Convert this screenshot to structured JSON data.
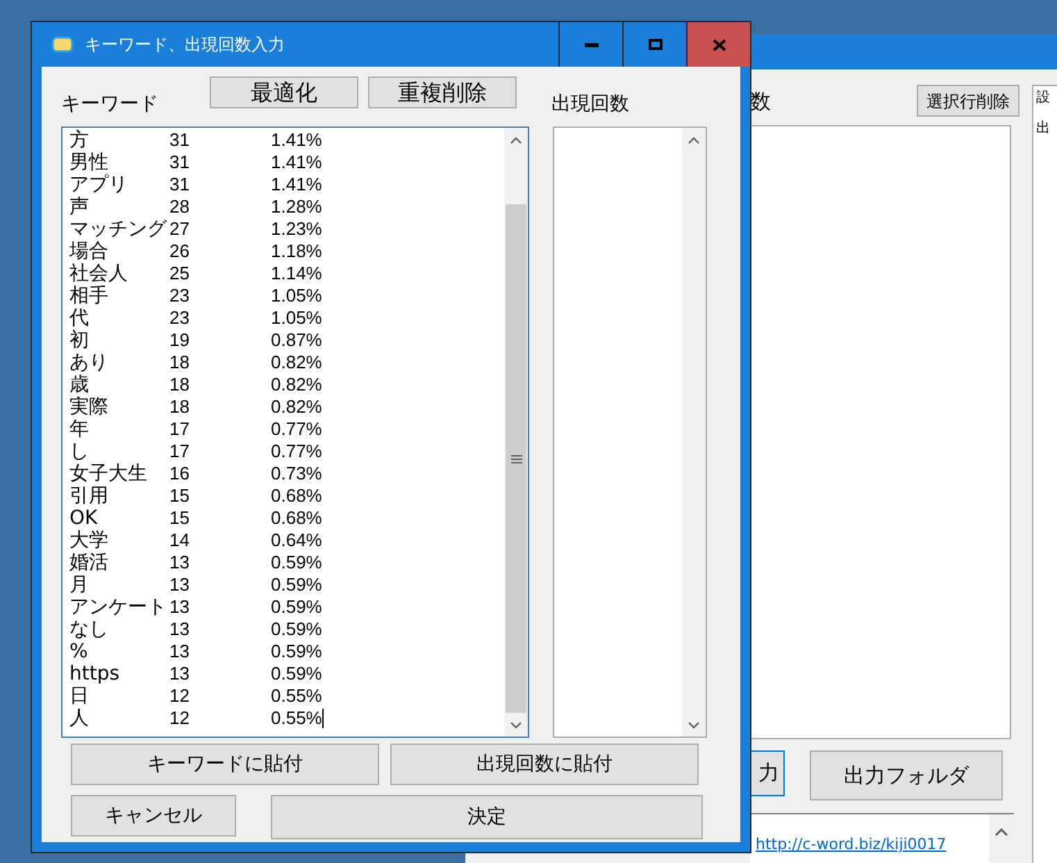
{
  "background_window": {
    "count_label": "数",
    "delete_button": "選択行削除",
    "right_panel": {
      "tab": "設",
      "label": "出"
    },
    "buttons": [
      {
        "label": "力",
        "focused": true
      },
      {
        "label": "出力フォルダ",
        "focused": false
      }
    ],
    "link": "http://c-word.biz/kiji0017"
  },
  "dialog": {
    "title": "キーワード、出現回数入力",
    "keyword_label": "キーワード",
    "count_label": "出現回数",
    "top_buttons": [
      "最適化",
      "重複削除"
    ],
    "keywords": [
      {
        "word": "方",
        "count": "31",
        "percent": "1.41%"
      },
      {
        "word": "男性",
        "count": "31",
        "percent": "1.41%"
      },
      {
        "word": "アプリ",
        "count": "31",
        "percent": "1.41%"
      },
      {
        "word": "声",
        "count": "28",
        "percent": "1.28%"
      },
      {
        "word": "マッチング",
        "count": "27",
        "percent": "1.23%"
      },
      {
        "word": "場合",
        "count": "26",
        "percent": "1.18%"
      },
      {
        "word": "社会人",
        "count": "25",
        "percent": "1.14%"
      },
      {
        "word": "相手",
        "count": "23",
        "percent": "1.05%"
      },
      {
        "word": "代",
        "count": "23",
        "percent": "1.05%"
      },
      {
        "word": "初",
        "count": "19",
        "percent": "0.87%"
      },
      {
        "word": "あり",
        "count": "18",
        "percent": "0.82%"
      },
      {
        "word": "歳",
        "count": "18",
        "percent": "0.82%"
      },
      {
        "word": "実際",
        "count": "18",
        "percent": "0.82%"
      },
      {
        "word": "年",
        "count": "17",
        "percent": "0.77%"
      },
      {
        "word": "し",
        "count": "17",
        "percent": "0.77%"
      },
      {
        "word": "女子大生",
        "count": "16",
        "percent": "0.73%"
      },
      {
        "word": "引用",
        "count": "15",
        "percent": "0.68%"
      },
      {
        "word": "OK",
        "count": "15",
        "percent": "0.68%"
      },
      {
        "word": "大学",
        "count": "14",
        "percent": "0.64%"
      },
      {
        "word": "婚活",
        "count": "13",
        "percent": "0.59%"
      },
      {
        "word": "月",
        "count": "13",
        "percent": "0.59%"
      },
      {
        "word": "アンケート",
        "count": "13",
        "percent": "0.59%"
      },
      {
        "word": "なし",
        "count": "13",
        "percent": "0.59%"
      },
      {
        "word": "%",
        "count": "13",
        "percent": "0.59%"
      },
      {
        "word": "https",
        "count": "13",
        "percent": "0.59%"
      },
      {
        "word": "日",
        "count": "12",
        "percent": "0.55%"
      },
      {
        "word": "人",
        "count": "12",
        "percent": "0.55%"
      }
    ],
    "paste_buttons": [
      "キーワードに貼付",
      "出現回数に貼付"
    ],
    "cancel_button": "キャンセル",
    "ok_button": "決定"
  }
}
